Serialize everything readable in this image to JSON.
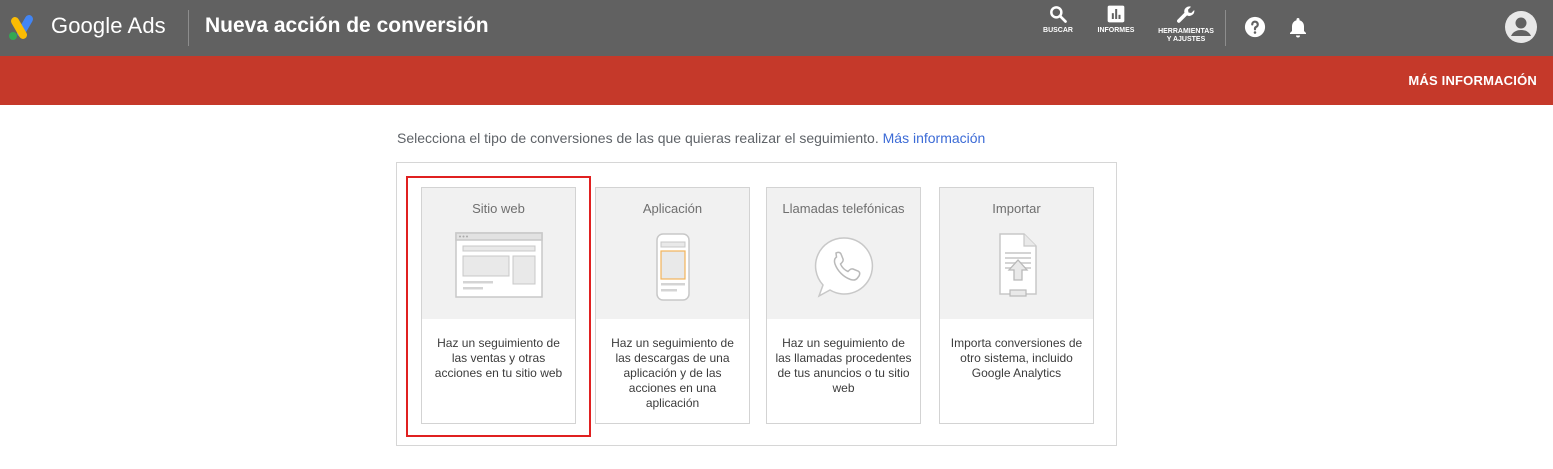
{
  "header": {
    "brand": "Google Ads",
    "title": "Nueva acción de conversión",
    "tools": [
      {
        "label": "BUSCAR",
        "icon": "search-icon"
      },
      {
        "label": "INFORMES",
        "icon": "reports-icon"
      },
      {
        "label_line1": "HERRAMIENTAS",
        "label_line2": "Y AJUSTES",
        "icon": "wrench-icon"
      }
    ],
    "help_icon": "help-icon",
    "notifications_icon": "bell-icon",
    "account_icon": "account-avatar-icon"
  },
  "banner": {
    "link": "MÁS INFORMACIÓN",
    "color": "#c5392a"
  },
  "main": {
    "intro_text": "Selecciona el tipo de conversiones de las que quieras realizar el seguimiento.",
    "intro_link": "Más información",
    "conversion_types": [
      {
        "title": "Sitio web",
        "description": "Haz un seguimiento de las ventas y otras acciones en tu sitio web",
        "icon": "website-illustration"
      },
      {
        "title": "Aplicación",
        "description": "Haz un seguimiento de las descargas de una aplicación y de las acciones en una aplicación",
        "icon": "mobile-app-illustration"
      },
      {
        "title": "Llamadas telefónicas",
        "description": "Haz un seguimiento de las llamadas procedentes de tus anuncios o tu sitio web",
        "icon": "phone-call-illustration"
      },
      {
        "title": "Importar",
        "description": "Importa conversiones de otro sistema, incluido Google Analytics",
        "icon": "import-file-illustration"
      }
    ],
    "highlighted_card": "Sitio web"
  },
  "colors": {
    "topbar": "#616161",
    "banner": "#c5392a",
    "link": "#3c6bd6",
    "highlight": "#e02020"
  }
}
